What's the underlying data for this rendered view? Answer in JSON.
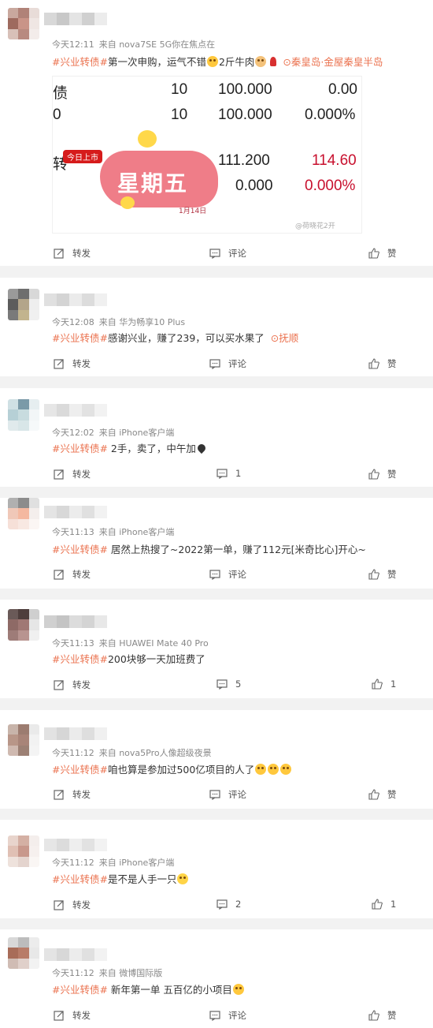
{
  "colors": {
    "accent": "#eb7350",
    "background": "#f2f2f2",
    "card": "#ffffff",
    "meta": "#888888",
    "red": "#c8102e"
  },
  "actions": {
    "repost": "转发",
    "comment": "评论",
    "like": "赞"
  },
  "posts": [
    {
      "time": "今天12:11",
      "source": "来自 nova7SE 5G你在焦点在",
      "hashtag": "#兴业转债#",
      "body": "第一次申购，运气不错",
      "body2": "2斤牛肉",
      "location": "秦皇岛·金屋秦皇半岛",
      "embed": {
        "rows": [
          {
            "c1": "债",
            "c2": "10",
            "c3": "100.000",
            "c4": "0.00"
          },
          {
            "c1": "0",
            "c2": "10",
            "c3": "100.000",
            "c4": "0.000%"
          },
          {
            "c1": "转",
            "c2": "",
            "c3": "111.200",
            "c4": "114.60"
          },
          {
            "c1": "",
            "c2": "",
            "c3": "0.000",
            "c4": "0.000%"
          }
        ],
        "badge": "今日上市",
        "sticker": "星期五",
        "sticker_date": "1月14日",
        "watermark": "@荷晓花2开"
      },
      "comment_count": "",
      "like_count": ""
    },
    {
      "time": "今天12:08",
      "source": "来自 华为畅享10 Plus",
      "hashtag": "#兴业转债#",
      "body": "感谢兴业，赚了239，可以买水果了",
      "location": "抚顺",
      "comment_count": "",
      "like_count": ""
    },
    {
      "time": "今天12:02",
      "source": "来自 iPhone客户端",
      "hashtag": "#兴业转债#",
      "body": " 2手，卖了，中午加",
      "comment_count": "1",
      "like_count": ""
    },
    {
      "time": "今天11:13",
      "source": "来自 iPhone客户端",
      "hashtag": "#兴业转债#",
      "body": " 居然上热搜了~2022第一单，赚了112元[米奇比心]开心~",
      "comment_count": "",
      "like_count": ""
    },
    {
      "time": "今天11:13",
      "source": "来自 HUAWEI Mate 40 Pro",
      "hashtag": "#兴业转债#",
      "body": "200块够一天加班费了",
      "comment_count": "5",
      "like_count": "1"
    },
    {
      "time": "今天11:12",
      "source": "来自 nova5Pro人像超级夜景",
      "hashtag": "#兴业转债#",
      "body": "咱也算是参加过500亿项目的人了",
      "comment_count": "",
      "like_count": ""
    },
    {
      "time": "今天11:12",
      "source": "来自 iPhone客户端",
      "hashtag": "#兴业转债#",
      "body": "是不是人手一只",
      "comment_count": "2",
      "like_count": "1"
    },
    {
      "time": "今天11:12",
      "source": "来自 微博国际版",
      "hashtag": "#兴业转债#",
      "body": " 新年第一单 五百亿的小项目",
      "comment_count": "",
      "like_count": ""
    }
  ]
}
